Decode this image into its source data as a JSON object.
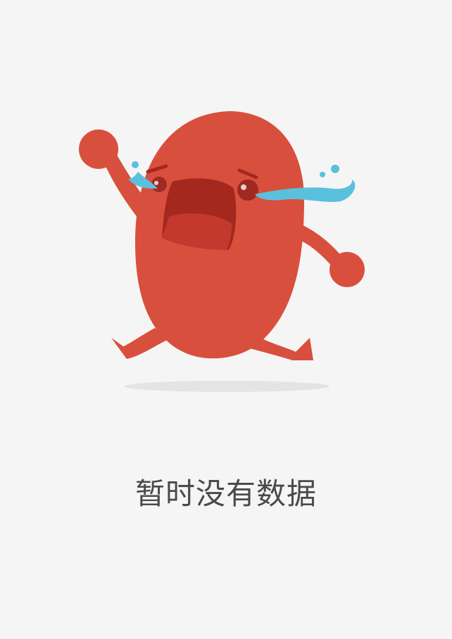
{
  "empty_state": {
    "message": "暂时没有数据",
    "illustration": "crying-bean-character"
  },
  "colors": {
    "background": "#f5f5f5",
    "body": "#d94f3d",
    "mouth_outer": "#a5281e",
    "mouth_inner": "#c0392b",
    "eye": "#9e2a22",
    "tears": "#5bc0de",
    "shadow": "#e4e4e4",
    "text": "#4a4a4a"
  }
}
